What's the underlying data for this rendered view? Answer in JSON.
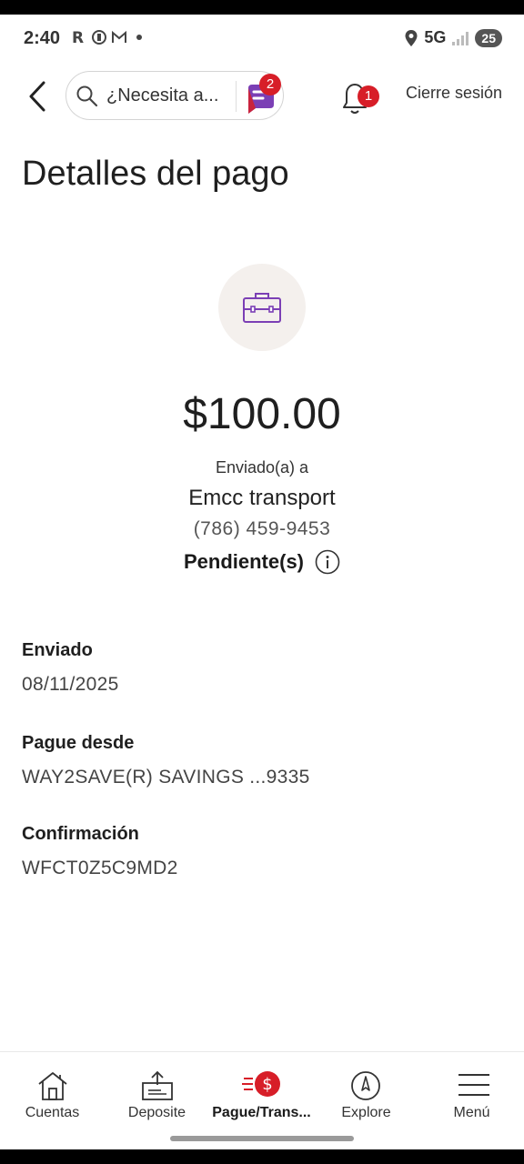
{
  "status_bar": {
    "time": "2:40",
    "network": "5G",
    "battery": "25",
    "icons": [
      "r-icon",
      "circle-icon",
      "mail-icon",
      "dot-icon",
      "location-icon",
      "signal-icon"
    ]
  },
  "header": {
    "search_placeholder": "¿Necesita a...",
    "assistant_badge": "2",
    "notifications_badge": "1",
    "logout_label": "Cierre sesión"
  },
  "page": {
    "title": "Detalles del pago"
  },
  "payment": {
    "amount": "$100.00",
    "sent_to_label": "Enviado(a) a",
    "payee": "Emcc transport",
    "phone": "(786) 459-9453",
    "status": "Pendiente(s)"
  },
  "details": [
    {
      "label": "Enviado",
      "value": "08/11/2025"
    },
    {
      "label": "Pague desde",
      "value": "WAY2SAVE(R) SAVINGS ...9335"
    },
    {
      "label": "Confirmación",
      "value": "WFCT0Z5C9MD2"
    }
  ],
  "bottom_nav": [
    {
      "label": "Cuentas",
      "icon": "home-icon"
    },
    {
      "label": "Deposite",
      "icon": "deposit-icon"
    },
    {
      "label": "Pague/Trans...",
      "icon": "pay-transfer-icon",
      "active": true
    },
    {
      "label": "Explore",
      "icon": "compass-icon"
    },
    {
      "label": "Menú",
      "icon": "hamburger-icon"
    }
  ],
  "colors": {
    "accent_red": "#d71e28",
    "purple": "#7b3fb5",
    "icon_circle_bg": "#f4f0ed"
  }
}
